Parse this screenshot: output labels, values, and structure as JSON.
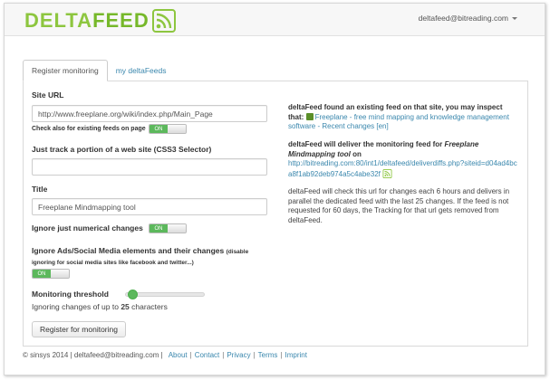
{
  "header": {
    "logo_delta": "DELTA",
    "logo_feed": "FEED",
    "user_email": "deltafeed@bitreading.com"
  },
  "tabs": [
    {
      "label": "Register monitoring",
      "active": true
    },
    {
      "label": "my deltaFeeds",
      "active": false
    }
  ],
  "form": {
    "site_url_label": "Site URL",
    "site_url_value": "http://www.freeplane.org/wiki/index.php/Main_Page",
    "check_existing_label": "Check also for existing feeds on page",
    "check_existing_toggle": "ON",
    "css_selector_label": "Just track a portion of a web site (CSS3 Selector)",
    "css_selector_value": "",
    "title_label": "Title",
    "title_value": "Freeplane Mindmapping tool",
    "ignore_numerical_label": "Ignore just numerical changes",
    "ignore_numerical_toggle": "ON",
    "ignore_ads_label": "Ignore Ads/Social Media elements and their changes",
    "ignore_ads_hint": "(disable ignoring for social media sites like facebook and twitter...)",
    "ignore_ads_toggle": "ON",
    "threshold_label": "Monitoring threshold",
    "threshold_value": 25,
    "threshold_fraction": 0.04,
    "threshold_prefix": "Ignoring changes of up to",
    "threshold_number": "25",
    "threshold_suffix": "characters",
    "submit_label": "Register for monitoring"
  },
  "info": {
    "found_text": "deltaFeed found an existing feed on that site, you may inspect that:",
    "found_link": "Freeplane - free mind mapping and knowledge management software - Recent changes [en]",
    "deliver_prefix": "deltaFeed will deliver the monitoring feed for",
    "deliver_title": "Freeplane Mindmapping tool",
    "deliver_on": "on",
    "deliver_url": "http://bitreading.com:80/int1/deltafeed/deliverdiffs.php?siteid=d04ad4bca8f1ab92deb974a5c4abe32f",
    "description": "deltaFeed will check this url for changes each 6 hours and delivers in parallel the dedicated feed with the last 25 changes. If the feed is not requested for 60 days, the Tracking for that url gets removed from deltaFeed."
  },
  "footer": {
    "copyright": "© sinsys 2014 | deltafeed@bitreading.com |",
    "links": [
      "About",
      "Contact",
      "Privacy",
      "Terms",
      "Imprint"
    ]
  },
  "colors": {
    "brand_green": "#8dc63f",
    "toggle_on": "#5cb85c",
    "link_blue": "#3a87ad"
  }
}
